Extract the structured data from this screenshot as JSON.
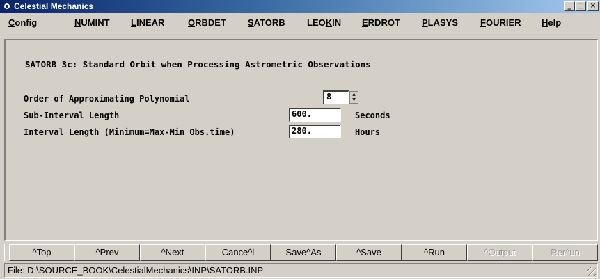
{
  "window": {
    "title": "Celestial Mechanics",
    "controls": {
      "minimize": "_",
      "maximize": "□",
      "close": "×"
    }
  },
  "menu": [
    {
      "pre": "",
      "u": "C",
      "post": "onfig"
    },
    {
      "pre": "",
      "u": "N",
      "post": "UMINT"
    },
    {
      "pre": "",
      "u": "L",
      "post": "INEAR"
    },
    {
      "pre": "",
      "u": "O",
      "post": "RBDET"
    },
    {
      "pre": "",
      "u": "S",
      "post": "ATORB"
    },
    {
      "pre": "LEO",
      "u": "K",
      "post": "IN"
    },
    {
      "pre": "",
      "u": "E",
      "post": "RDROT"
    },
    {
      "pre": "",
      "u": "P",
      "post": "LASYS"
    },
    {
      "pre": "",
      "u": "F",
      "post": "OURIER"
    },
    {
      "pre": "",
      "u": "H",
      "post": "elp"
    }
  ],
  "form": {
    "heading": "SATORB 3c: Standard Orbit when Processing Astrometric Observations",
    "order": {
      "label": "Order of Approximating Polynomial",
      "value": "8"
    },
    "subinterval": {
      "label": "Sub-Interval Length",
      "value": "600.",
      "unit": "Seconds"
    },
    "interval": {
      "label": "Interval Length (Minimum=Max-Min Obs.time)",
      "value": "280.",
      "unit": "Hours"
    }
  },
  "toolbar": {
    "top": "^Top",
    "prev": "^Prev",
    "next": "^Next",
    "cancel": "Cance^l",
    "saveas": "Save^As",
    "save": "^Save",
    "run": "^Run",
    "output": "^Output",
    "rerun": "Rer^un"
  },
  "status": {
    "text": "File: D:\\SOURCE_BOOK\\CelestialMechanics\\INP\\SATORB.INP"
  }
}
